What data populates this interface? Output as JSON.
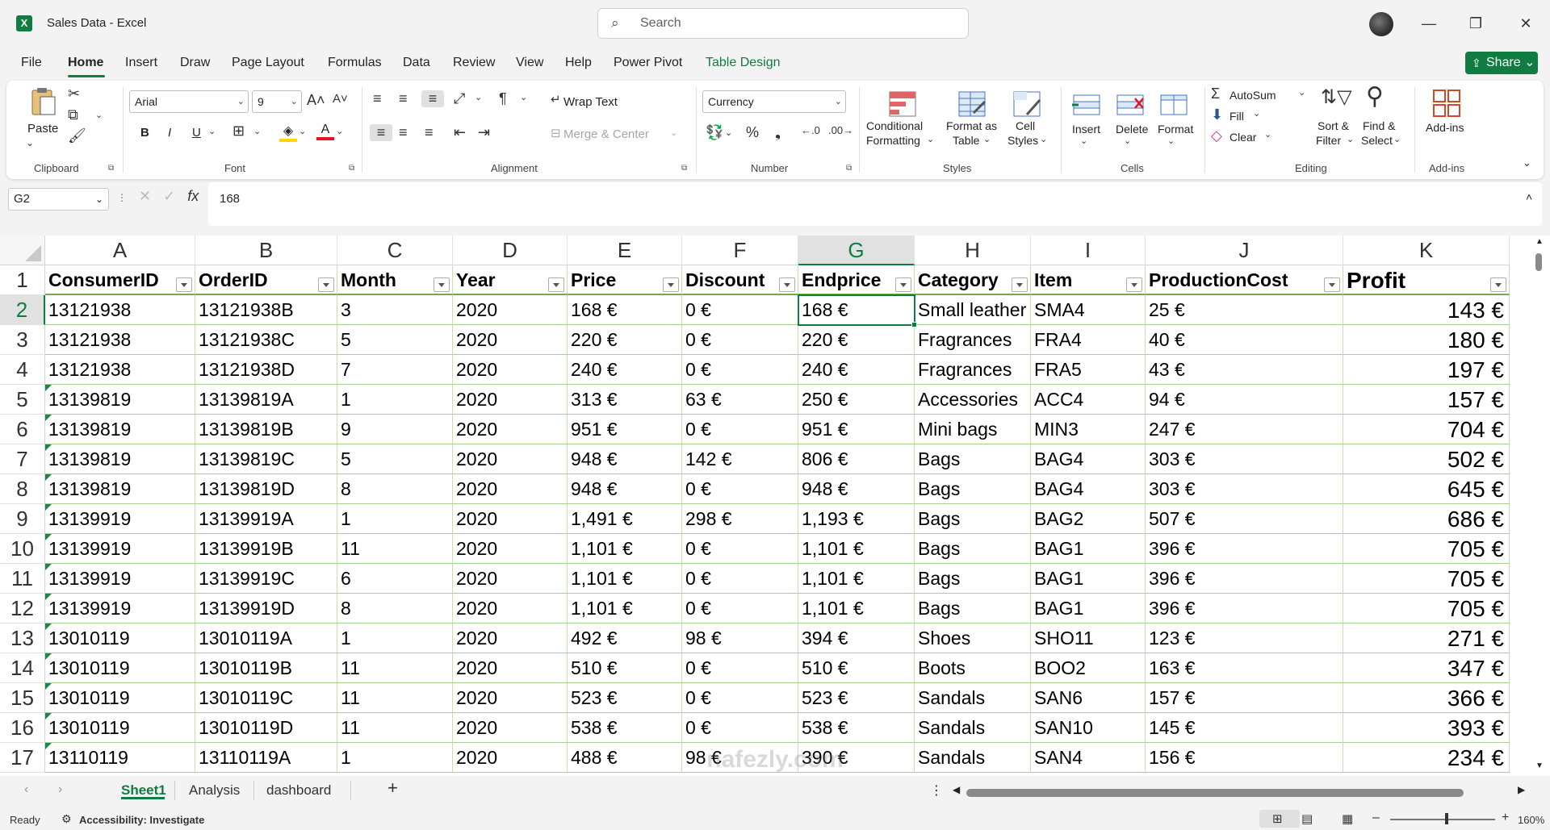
{
  "window": {
    "title": "Sales Data  -  Excel",
    "search_placeholder": "Search",
    "minimize": "—",
    "restore": "❐",
    "close": "✕"
  },
  "menu": {
    "items": [
      "File",
      "Home",
      "Insert",
      "Draw",
      "Page Layout",
      "Formulas",
      "Data",
      "Review",
      "View",
      "Help",
      "Power Pivot",
      "Table Design"
    ],
    "active": "Home",
    "share_label": "Share"
  },
  "ribbon": {
    "clipboard": {
      "paste": "Paste",
      "label": "Clipboard"
    },
    "font": {
      "name": "Arial",
      "size": "9",
      "bold": "B",
      "italic": "I",
      "underline": "U",
      "label": "Font"
    },
    "alignment": {
      "wrap_text": "Wrap Text",
      "merge_center": "Merge & Center",
      "label": "Alignment"
    },
    "number": {
      "format": "Currency",
      "label": "Number"
    },
    "styles": {
      "conditional": "Conditional",
      "formatting": "Formatting",
      "format_as": "Format as",
      "table": "Table",
      "cell": "Cell",
      "cell_styles": "Styles",
      "label": "Styles"
    },
    "cells": {
      "insert": "Insert",
      "delete": "Delete",
      "format": "Format",
      "label": "Cells"
    },
    "editing": {
      "autosum": "AutoSum",
      "fill": "Fill",
      "clear": "Clear",
      "sort": "Sort &",
      "filter": "Filter",
      "find": "Find &",
      "select": "Select",
      "label": "Editing"
    },
    "addins": {
      "addins": "Add-ins",
      "label": "Add-ins"
    }
  },
  "formula_bar": {
    "name_box": "G2",
    "fx": "fx",
    "value": "168"
  },
  "sheet": {
    "columns": [
      "A",
      "B",
      "C",
      "D",
      "E",
      "F",
      "G",
      "H",
      "I",
      "J",
      "K"
    ],
    "selected_column": "G",
    "headers": [
      "ConsumerID",
      "OrderID",
      "Month",
      "Year",
      "Price",
      "Discount",
      "Endprice",
      "Category",
      "Item",
      "ProductionCost",
      "Profit"
    ],
    "rows": [
      [
        "13121938",
        "13121938B",
        "3",
        "2020",
        "168 €",
        "0 €",
        "168 €",
        "Small leather",
        "SMA4",
        "25 €",
        "143 €"
      ],
      [
        "13121938",
        "13121938C",
        "5",
        "2020",
        "220 €",
        "0 €",
        "220 €",
        "Fragrances",
        "FRA4",
        "40 €",
        "180 €"
      ],
      [
        "13121938",
        "13121938D",
        "7",
        "2020",
        "240 €",
        "0 €",
        "240 €",
        "Fragrances",
        "FRA5",
        "43 €",
        "197 €"
      ],
      [
        "13139819",
        "13139819A",
        "1",
        "2020",
        "313 €",
        "63 €",
        "250 €",
        "Accessories",
        "ACC4",
        "94 €",
        "157 €"
      ],
      [
        "13139819",
        "13139819B",
        "9",
        "2020",
        "951 €",
        "0 €",
        "951 €",
        "Mini bags",
        "MIN3",
        "247 €",
        "704 €"
      ],
      [
        "13139819",
        "13139819C",
        "5",
        "2020",
        "948 €",
        "142 €",
        "806 €",
        "Bags",
        "BAG4",
        "303 €",
        "502 €"
      ],
      [
        "13139819",
        "13139819D",
        "8",
        "2020",
        "948 €",
        "0 €",
        "948 €",
        "Bags",
        "BAG4",
        "303 €",
        "645 €"
      ],
      [
        "13139919",
        "13139919A",
        "1",
        "2020",
        "1,491 €",
        "298 €",
        "1,193 €",
        "Bags",
        "BAG2",
        "507 €",
        "686 €"
      ],
      [
        "13139919",
        "13139919B",
        "11",
        "2020",
        "1,101 €",
        "0 €",
        "1,101 €",
        "Bags",
        "BAG1",
        "396 €",
        "705 €"
      ],
      [
        "13139919",
        "13139919C",
        "6",
        "2020",
        "1,101 €",
        "0 €",
        "1,101 €",
        "Bags",
        "BAG1",
        "396 €",
        "705 €"
      ],
      [
        "13139919",
        "13139919D",
        "8",
        "2020",
        "1,101 €",
        "0 €",
        "1,101 €",
        "Bags",
        "BAG1",
        "396 €",
        "705 €"
      ],
      [
        "13010119",
        "13010119A",
        "1",
        "2020",
        "492 €",
        "98 €",
        "394 €",
        "Shoes",
        "SHO11",
        "123 €",
        "271 €"
      ],
      [
        "13010119",
        "13010119B",
        "11",
        "2020",
        "510 €",
        "0 €",
        "510 €",
        "Boots",
        "BOO2",
        "163 €",
        "347 €"
      ],
      [
        "13010119",
        "13010119C",
        "11",
        "2020",
        "523 €",
        "0 €",
        "523 €",
        "Sandals",
        "SAN6",
        "157 €",
        "366 €"
      ],
      [
        "13010119",
        "13010119D",
        "11",
        "2020",
        "538 €",
        "0 €",
        "538 €",
        "Sandals",
        "SAN10",
        "145 €",
        "393 €"
      ],
      [
        "13110119",
        "13110119A",
        "1",
        "2020",
        "488 €",
        "98 €",
        "390 €",
        "Sandals",
        "SAN4",
        "156 €",
        "234 €"
      ]
    ],
    "row_numbers": [
      "1",
      "2",
      "3",
      "4",
      "5",
      "6",
      "7",
      "8",
      "9",
      "10",
      "11",
      "12",
      "13",
      "14",
      "15",
      "16",
      "17"
    ]
  },
  "tabs": {
    "items": [
      "Sheet1",
      "Analysis",
      "dashboard"
    ],
    "active": "Sheet1",
    "add": "+"
  },
  "status": {
    "ready": "Ready",
    "accessibility": "Accessibility: Investigate",
    "zoom": "160%"
  },
  "watermark": "nafezly.com",
  "colors": {
    "accent": "#107c41",
    "table_border": "#a9d08e"
  }
}
